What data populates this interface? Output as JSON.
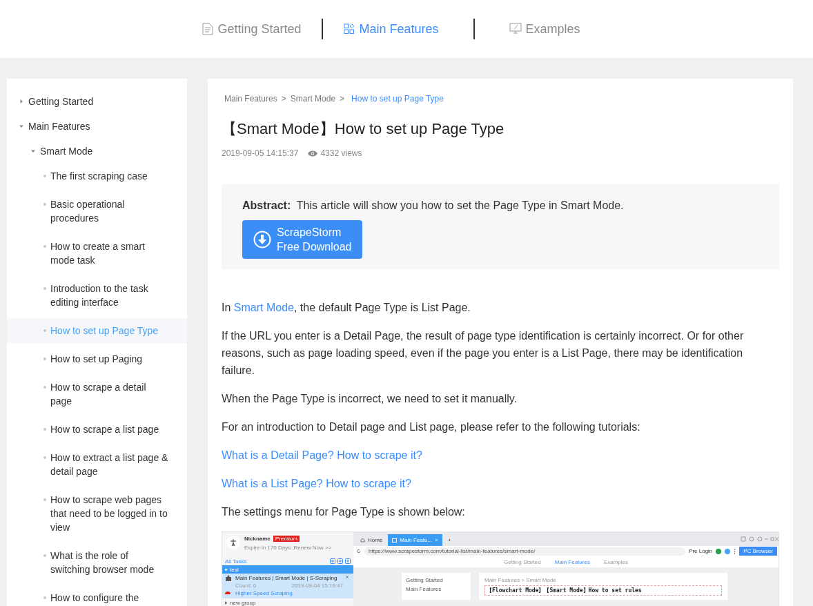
{
  "top_nav": [
    {
      "label": "Getting Started",
      "selected": false
    },
    {
      "label": "Main Features",
      "selected": true
    },
    {
      "label": "Examples",
      "selected": false
    }
  ],
  "sidebar": {
    "items": [
      {
        "label": "Getting Started",
        "expanded": false
      },
      {
        "label": "Main Features",
        "expanded": true,
        "children": [
          {
            "label": "Smart Mode",
            "expanded": true,
            "children": [
              {
                "label": "The first scraping case",
                "selected": false
              },
              {
                "label": "Basic operational procedures",
                "selected": false
              },
              {
                "label": "How to create a smart mode task",
                "selected": false
              },
              {
                "label": "Introduction to the task editing interface",
                "selected": false
              },
              {
                "label": "How to set up Page Type",
                "selected": true
              },
              {
                "label": "How to set up Paging",
                "selected": false
              },
              {
                "label": "How to scrape a detail page",
                "selected": false
              },
              {
                "label": "How to scrape a list page",
                "selected": false
              },
              {
                "label": "How to extract a list page & detail page",
                "selected": false
              },
              {
                "label": "How to scrape web pages that need to be logged in to view",
                "selected": false
              },
              {
                "label": "What is the role of switching browser mode",
                "selected": false
              },
              {
                "label": "How to configure the",
                "selected": false
              }
            ]
          }
        ]
      }
    ]
  },
  "article": {
    "breadcrumb": [
      "Main Features",
      "Smart Mode",
      "How to set up Page Type"
    ],
    "separator": ">",
    "title": "【Smart Mode】How to set up Page Type",
    "date": "2019-09-05 14:15:37",
    "views": "4332 views",
    "abstract": {
      "label": "Abstract:",
      "text": "This article will show you how to set the Page Type in Smart Mode.",
      "button": [
        "ScrapeStorm",
        "Free Download"
      ]
    },
    "paragraphs": [
      {
        "kind": "mixed",
        "before": "In ",
        "link": "Smart Mode",
        "after": ", the default Page Type is List Page."
      },
      {
        "kind": "text",
        "text": "If the URL you enter is a Detail Page, the result of page type identification is certainly incorrect. Or for other reasons, such as page loading speed, even if the page you enter is a List Page, there may be identification failure."
      },
      {
        "kind": "text",
        "text": "When the Page Type is incorrect, we need to set it manually."
      },
      {
        "kind": "text",
        "text": "For an introduction to Detail page and List page, please refer to the following tutorials:"
      },
      {
        "kind": "link",
        "text": "What is a Detail Page? How to scrape it?"
      },
      {
        "kind": "link",
        "text": "What is a List Page? How to scrape it?"
      },
      {
        "kind": "text",
        "text": "The settings menu for Page Type is shown below:"
      }
    ],
    "screenshot": {
      "nickname": "Nickname",
      "badge": "Premium",
      "expire": "Expire in 170 Days ,Renew Now >>",
      "all_tasks": "All Tasks",
      "groups": [
        {
          "label": "test",
          "expanded": true,
          "selected": true
        },
        {
          "label": "new group",
          "expanded": false,
          "selected": false
        }
      ],
      "task": {
        "title": "Main Features | Smart Mode | S-Scraping",
        "count": "Count: 6",
        "date": "2019-09-04 15:19:47",
        "speed": "Higher Speed Scraping"
      },
      "tabs": [
        {
          "label": "Home",
          "selected": false
        },
        {
          "label": "Main Featu...",
          "selected": true
        }
      ],
      "new_tab": "+",
      "url": "https://www.scrapestorm.com/tutorial-list/main-features/smart-mode/",
      "pre_login": "Pre Login",
      "browser_button": "PC Browser",
      "inner_nav": [
        "Getting Started",
        "Main Features",
        "Examples"
      ],
      "inner_sidebar": [
        "Getting Started",
        "Main Features"
      ],
      "inner_breadcrumb": "Main Features > Smart Mode",
      "inner_title": "【Flowchart Mode】【Smart Mode】How to set rules"
    }
  }
}
